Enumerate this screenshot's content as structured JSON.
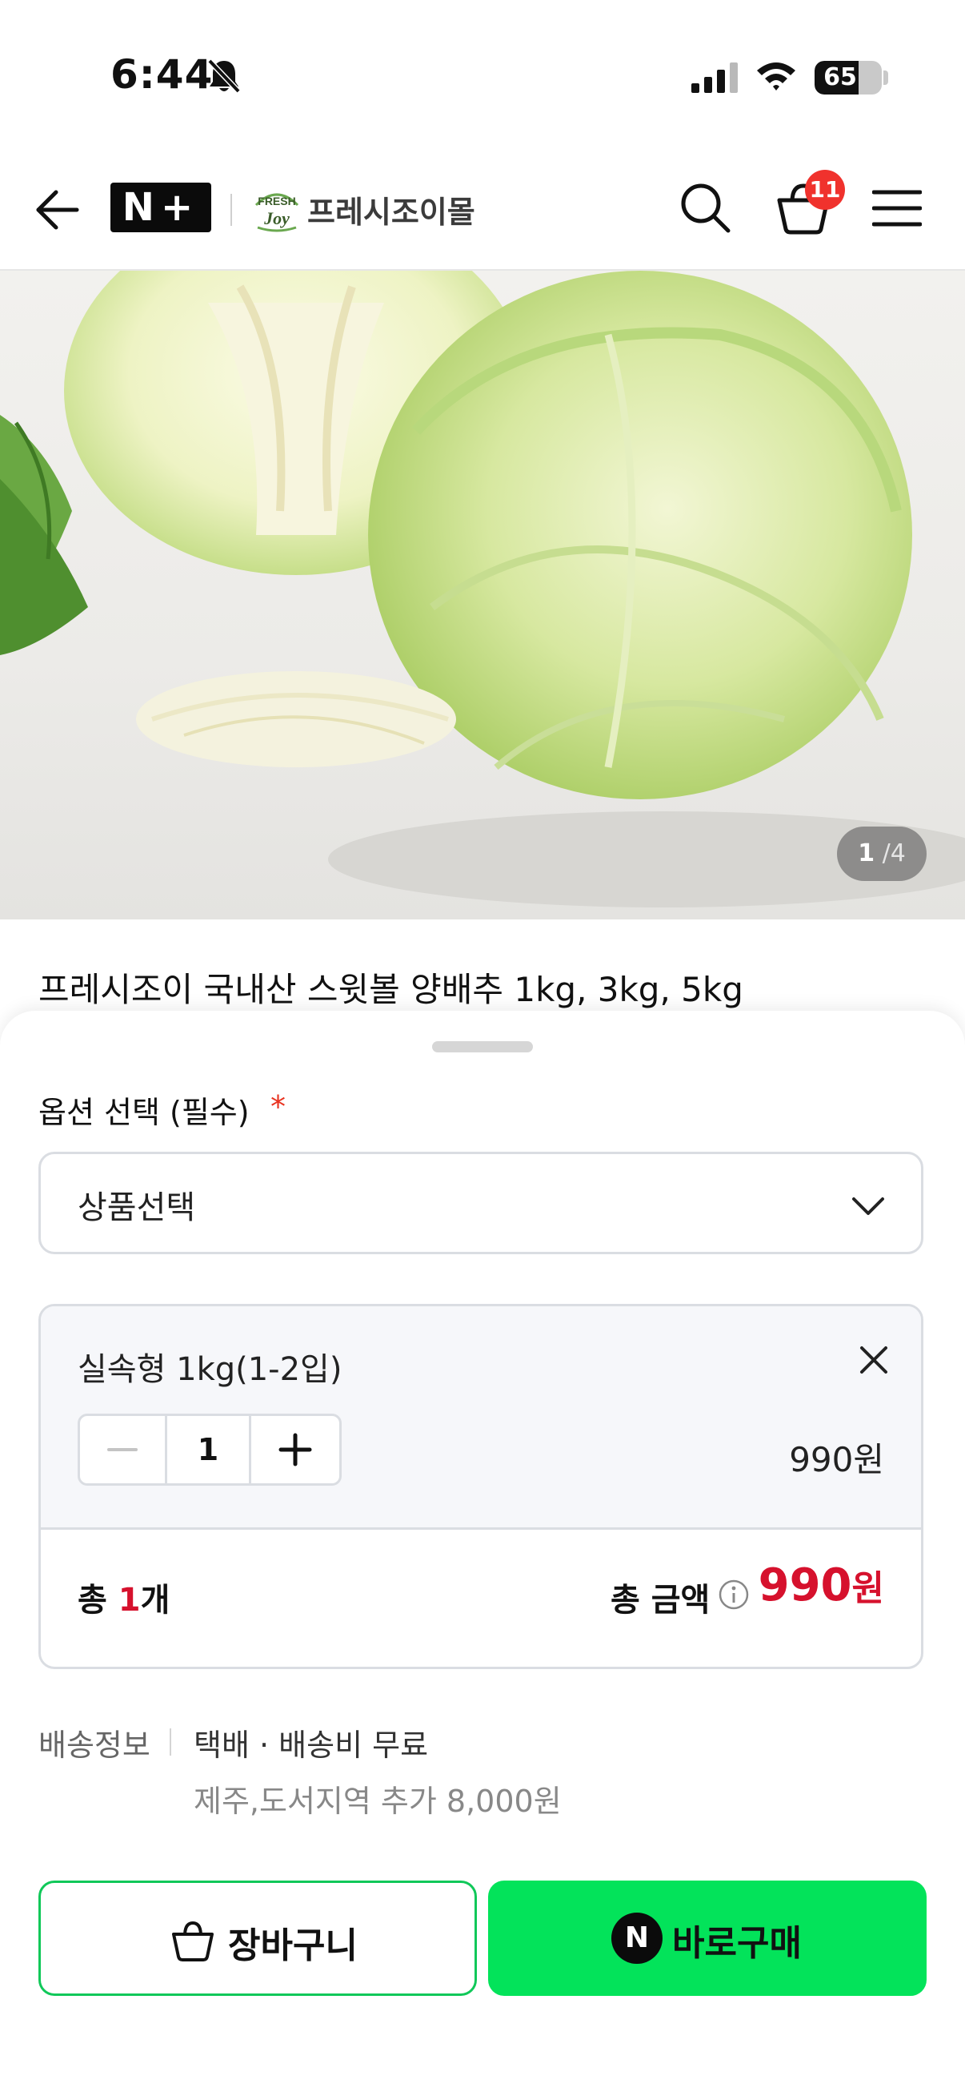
{
  "status_bar": {
    "time": "6:44",
    "battery": "65",
    "battery_level": 0.65
  },
  "header": {
    "brand_logo": "N+",
    "store_name": "프레시조이몰",
    "store_logo_text": "FRESH JOY",
    "cart_count": "11"
  },
  "gallery": {
    "current": "1",
    "separator": "/",
    "total": "4"
  },
  "product": {
    "title": "프레시조이 국내산 스윗볼 양배추 1kg, 3kg, 5kg"
  },
  "option": {
    "label": "옵션 선택 (필수)",
    "required_mark": "*",
    "select_value": "상품선택",
    "selected_item": {
      "name": "실속형 1kg(1-2입)",
      "quantity": "1",
      "price": "990원"
    }
  },
  "summary": {
    "count_prefix": "총 ",
    "count": "1",
    "count_suffix": "개",
    "total_label": "총 금액",
    "total_value": "990",
    "total_unit": "원"
  },
  "shipping": {
    "label": "배송정보",
    "info": "택배 · 배송비 무료",
    "extra": "제주,도서지역 추가 8,000원"
  },
  "actions": {
    "cart_label": "장바구니",
    "buy_label": "바로구매",
    "buy_icon_text": "N"
  },
  "colors": {
    "accent_green": "#03e35a",
    "price_red": "#d6112d",
    "badge_red": "#f0322d"
  }
}
